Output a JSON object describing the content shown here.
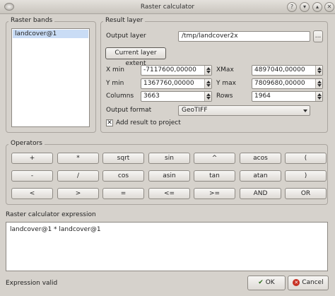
{
  "window": {
    "title": "Raster calculator",
    "help_glyph": "?",
    "minimize_glyph": "▾",
    "maximize_glyph": "▴",
    "close_glyph": "✕"
  },
  "raster_bands": {
    "title": "Raster bands",
    "items": [
      "landcover@1"
    ]
  },
  "result_layer": {
    "title": "Result layer",
    "output_layer_label": "Output layer",
    "output_layer_value": "/tmp/landcover2x",
    "browse_label": "...",
    "current_extent_label": "Current layer extent",
    "xmin_label": "X min",
    "xmin_value": "-7117600,00000",
    "xmax_label": "XMax",
    "xmax_value": "4897040,00000",
    "ymin_label": "Y min",
    "ymin_value": "1367760,00000",
    "ymax_label": "Y max",
    "ymax_value": "7809680,00000",
    "columns_label": "Columns",
    "columns_value": "3663",
    "rows_label": "Rows",
    "rows_value": "1964",
    "format_label": "Output format",
    "format_value": "GeoTIFF",
    "add_result_label": "Add result to project",
    "add_result_checked": "✕"
  },
  "operators": {
    "title": "Operators",
    "rows": [
      [
        "+",
        "*",
        "sqrt",
        "sin",
        "^",
        "acos",
        "("
      ],
      [
        "-",
        "/",
        "cos",
        "asin",
        "tan",
        "atan",
        ")"
      ],
      [
        "<",
        ">",
        "=",
        "<=",
        ">=",
        "AND",
        "OR"
      ]
    ]
  },
  "expression": {
    "label": "Raster calculator expression",
    "value": "landcover@1 * landcover@1"
  },
  "status": "Expression valid",
  "buttons": {
    "ok_label": "OK",
    "ok_icon": "✔",
    "cancel_label": "Cancel",
    "cancel_icon": "✕"
  }
}
